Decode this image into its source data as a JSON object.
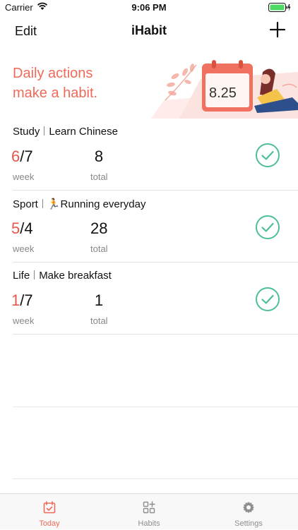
{
  "status_bar": {
    "carrier": "Carrier",
    "time": "9:06 PM"
  },
  "nav": {
    "edit_label": "Edit",
    "title": "iHabit"
  },
  "banner": {
    "line1": "Daily actions",
    "line2": "make a habit.",
    "calendar_date": "8.25"
  },
  "habits": [
    {
      "category": "Study",
      "name": "Learn Chinese",
      "week_done": "6",
      "week_target": "/7",
      "week_label": "week",
      "total": "8",
      "total_label": "total"
    },
    {
      "category": "Sport",
      "name": "🏃Running everyday",
      "week_done": "5",
      "week_target": "/4",
      "week_label": "week",
      "total": "28",
      "total_label": "total"
    },
    {
      "category": "Life",
      "name": "Make breakfast",
      "week_done": "1",
      "week_target": "/7",
      "week_label": "week",
      "total": "1",
      "total_label": "total"
    }
  ],
  "tabs": [
    {
      "label": "Today",
      "icon": "calendar-check-icon",
      "active": true
    },
    {
      "label": "Habits",
      "icon": "grid-icon",
      "active": false
    },
    {
      "label": "Settings",
      "icon": "gear-icon",
      "active": false
    }
  ],
  "colors": {
    "accent": "#ee6a5b",
    "check": "#4cbf94",
    "count_done": "#e5574b"
  }
}
